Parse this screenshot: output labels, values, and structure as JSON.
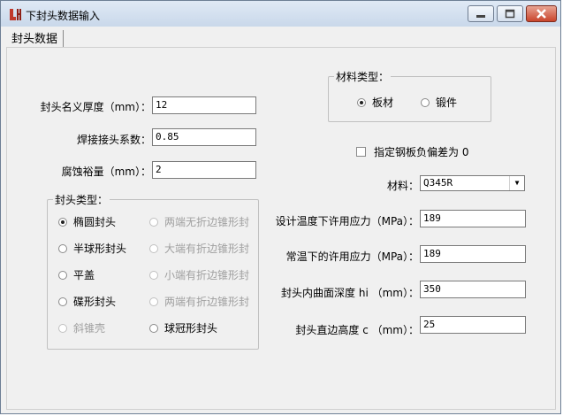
{
  "window": {
    "title": "下封头数据输入"
  },
  "tabs": [
    {
      "label": "封头数据"
    }
  ],
  "fields": {
    "thickness": {
      "label": "封头名义厚度（mm）：",
      "value": "12"
    },
    "weld_coef": {
      "label": "焊接接头系数：",
      "value": "0.85"
    },
    "corrosion": {
      "label": "腐蚀裕量（mm）：",
      "value": "2"
    },
    "design_stress": {
      "label": "设计温度下许用应力（MPa）：",
      "value": "189"
    },
    "room_stress": {
      "label": "常温下的许用应力（MPa）：",
      "value": "189"
    },
    "depth_hi": {
      "label": "封头内曲面深度 hi （mm）：",
      "value": "350"
    },
    "straight_c": {
      "label": "封头直边高度 c （mm）：",
      "value": "25"
    }
  },
  "head_type": {
    "legend": "封头类型：",
    "options": [
      {
        "label": "椭圆封头",
        "checked": true,
        "disabled": false
      },
      {
        "label": "两端无折边锥形封",
        "checked": false,
        "disabled": true
      },
      {
        "label": "半球形封头",
        "checked": false,
        "disabled": false
      },
      {
        "label": "大端有折边锥形封",
        "checked": false,
        "disabled": true
      },
      {
        "label": "平盖",
        "checked": false,
        "disabled": false
      },
      {
        "label": "小端有折边锥形封",
        "checked": false,
        "disabled": true
      },
      {
        "label": "碟形封头",
        "checked": false,
        "disabled": false
      },
      {
        "label": "两端有折边锥形封",
        "checked": false,
        "disabled": true
      },
      {
        "label": "斜锥壳",
        "checked": false,
        "disabled": true
      },
      {
        "label": "球冠形封头",
        "checked": false,
        "disabled": false
      }
    ]
  },
  "material_type": {
    "legend": "材料类型：",
    "options": [
      {
        "label": "板材",
        "checked": true
      },
      {
        "label": "锻件",
        "checked": false
      }
    ]
  },
  "deviation_check": {
    "label": "指定钢板负偏差为 0",
    "checked": false
  },
  "material": {
    "label": "材料：",
    "value": "Q345R"
  }
}
